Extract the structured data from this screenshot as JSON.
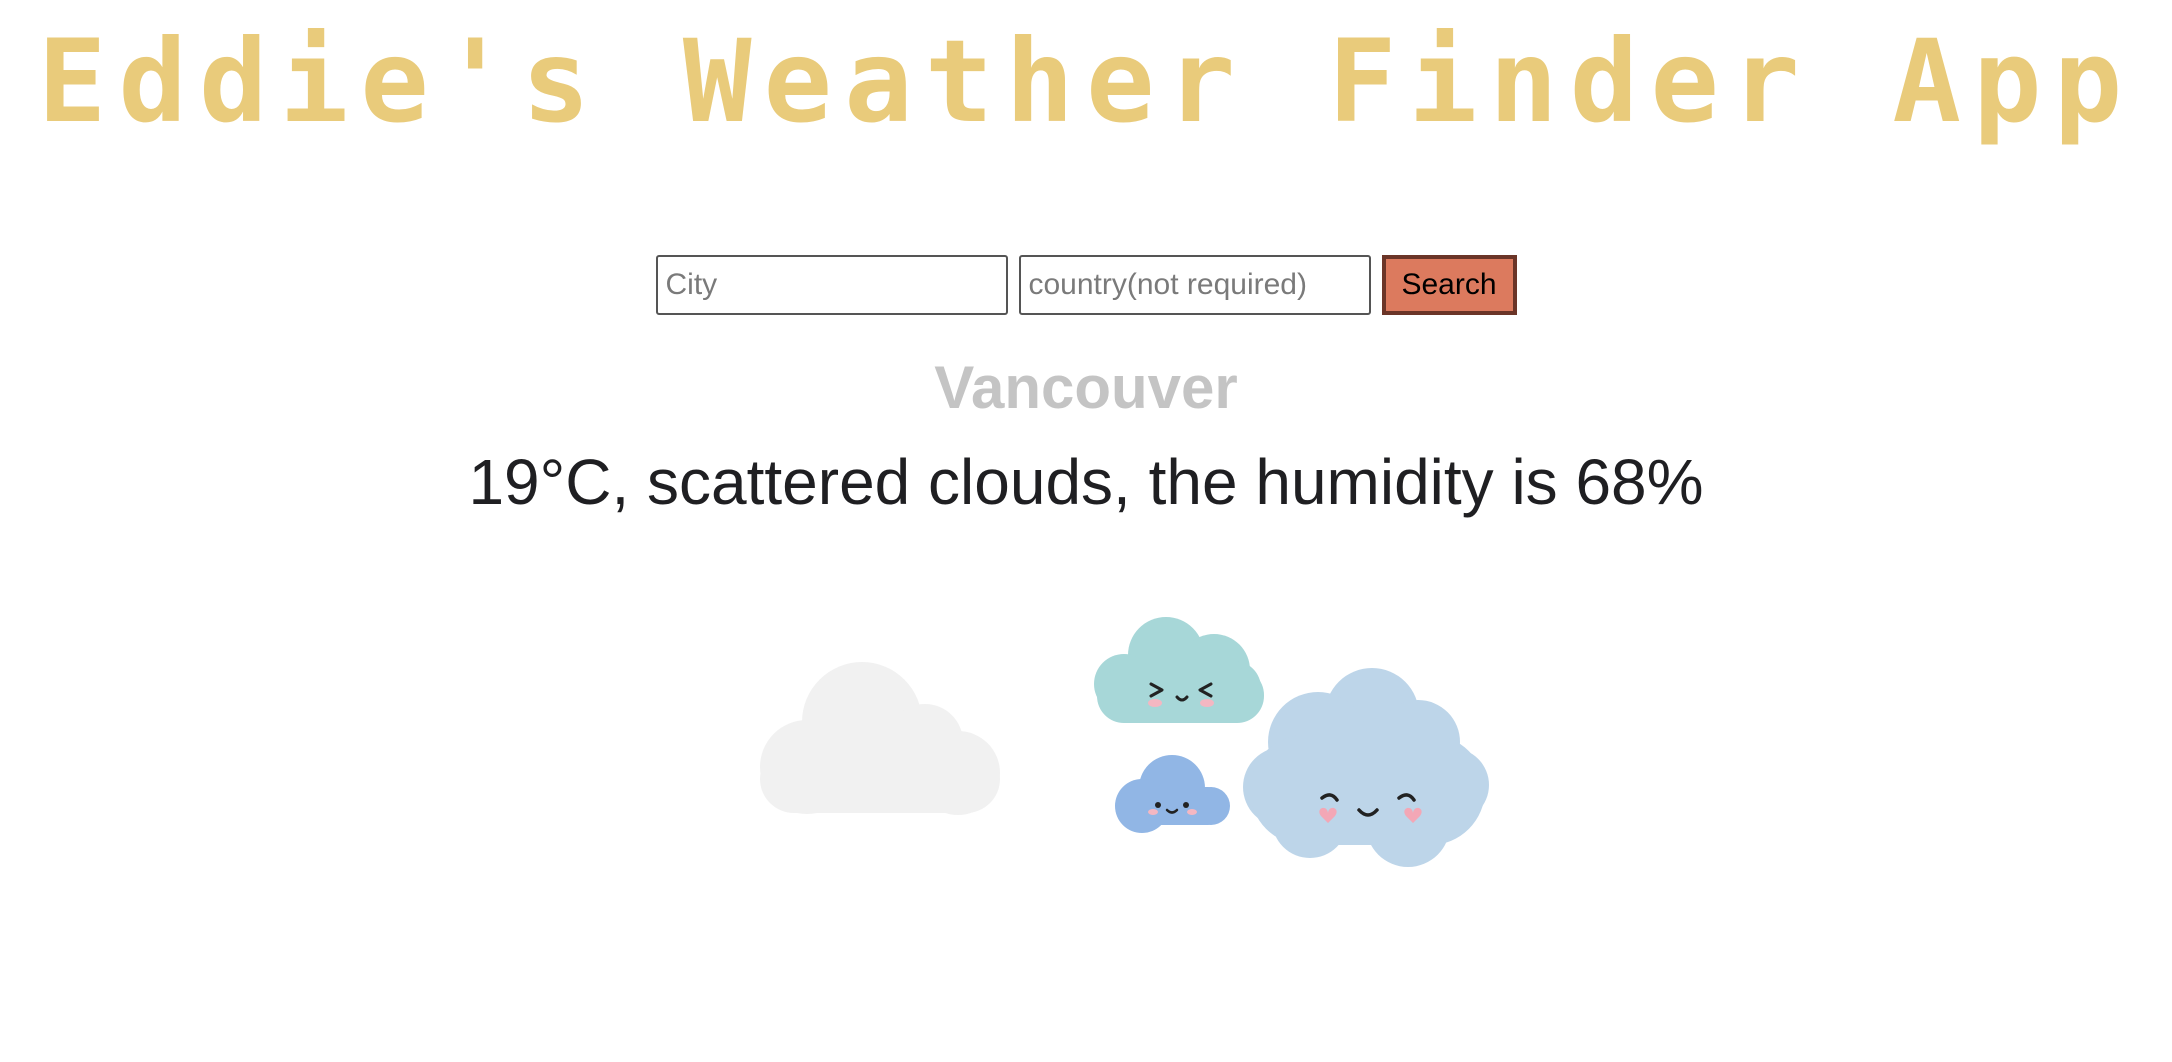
{
  "header": {
    "title": "Eddie's Weather Finder App"
  },
  "search": {
    "city_placeholder": "City",
    "city_value": "",
    "country_placeholder": "country(not required)",
    "country_value": "",
    "button_label": "Search"
  },
  "result": {
    "city": "Vancouver",
    "summary": "19°C, scattered clouds, the humidity is 68%"
  },
  "colors": {
    "title": "#e9cb7b",
    "button": "#dc7a5e",
    "button_border": "#6b3528",
    "city_text": "#c4c4c4",
    "summary_text": "#1f1f22"
  },
  "illustration": {
    "icon": "cute-clouds-icon"
  }
}
